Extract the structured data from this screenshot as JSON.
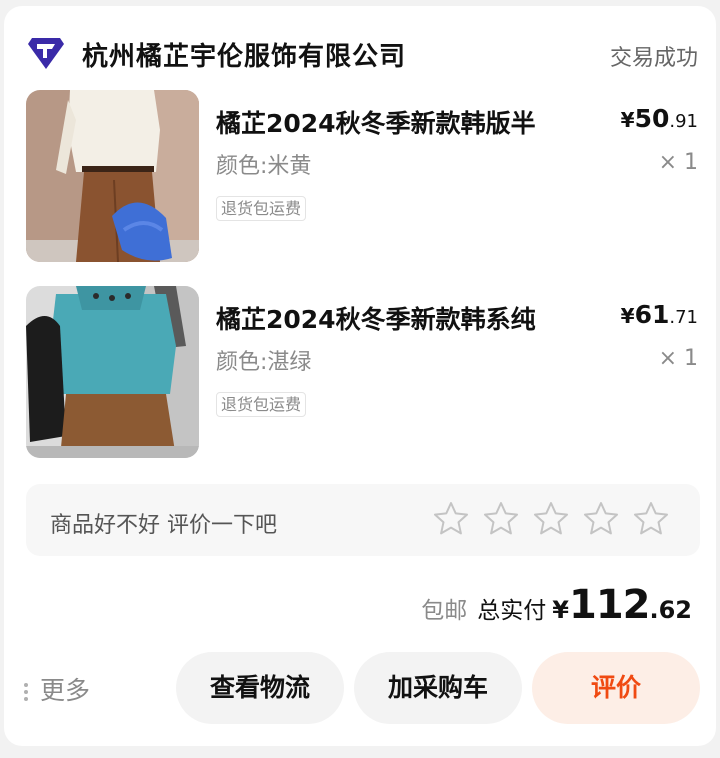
{
  "colors": {
    "background": "#f2f2f2",
    "card": "#ffffff",
    "accent": "#f04a12",
    "accent_soft": "#fdeee6",
    "logo": "#3a2aa8",
    "muted_text": "#8a8a8a"
  },
  "order": {
    "shop": {
      "name": "杭州橘芷宇伦服饰有限公司",
      "logo_icon": "shop-logo-icon"
    },
    "status": "交易成功",
    "items": [
      {
        "title": "橘芷2024秋冬季新款韩版半",
        "spec": "颜色:米黄",
        "badge": "退货包运费",
        "price_currency": "¥",
        "price_int": "50",
        "price_dec": ".91",
        "qty": "× 1",
        "image": "product-photo-cream-sweater-brown-pants"
      },
      {
        "title": "橘芷2024秋冬季新款韩系纯",
        "spec": "颜色:湛绿",
        "badge": "退货包运费",
        "price_currency": "¥",
        "price_int": "61",
        "price_dec": ".71",
        "qty": "× 1",
        "image": "product-photo-teal-sweater-brown-skirt"
      }
    ],
    "review": {
      "prompt": "商品好不好 评价一下吧",
      "star_count": 5,
      "star_icon": "star-outline-icon"
    },
    "total": {
      "shipping": "包邮",
      "label": "总实付",
      "currency": "¥",
      "int": "112",
      "dec": ".62"
    }
  },
  "actions": {
    "more": "更多",
    "logistics": "查看物流",
    "add_cart": "加采购车",
    "review": "评价"
  }
}
